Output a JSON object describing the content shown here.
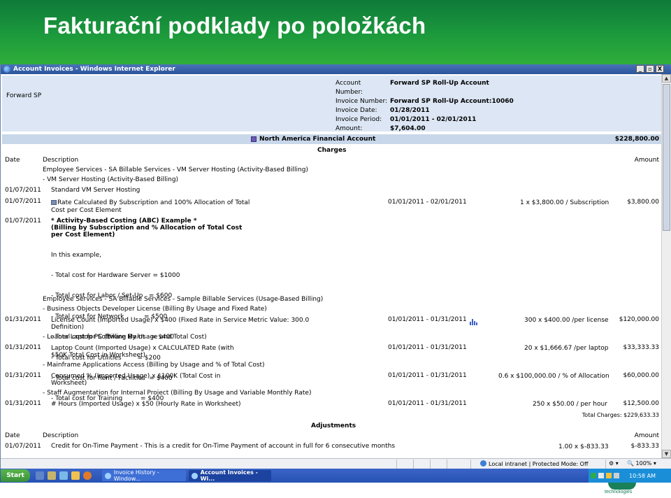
{
  "slide": {
    "title": "Fakturační podklady po položkách"
  },
  "window": {
    "title": "Account Invoices - Windows Internet Explorer",
    "buttons": [
      "_",
      "▫",
      "X"
    ]
  },
  "account": {
    "name": "Forward SP",
    "fields": [
      {
        "label": "Account Number:",
        "value": "Forward SP Roll-Up Account"
      },
      {
        "label": "Invoice Number:",
        "value": "Forward SP Roll-Up Account:10060"
      },
      {
        "label": "Invoice Date:",
        "value": "01/28/2011"
      },
      {
        "label": "Invoice Period:",
        "value": "01/01/2011 - 02/01/2011"
      },
      {
        "label": "Amount:",
        "value": "$7,604.00"
      }
    ]
  },
  "financial_account": {
    "name": "North America Financial Account",
    "amount": "$228,800.00"
  },
  "charges": {
    "heading": "Charges",
    "col_date": "Date",
    "col_desc": "Description",
    "col_amount": "Amount",
    "group1": "Employee Services - SA Billable Services - VM Server Hosting (Activity-Based Billing)",
    "sub1": "- VM Server Hosting (Activity-Based Billing)",
    "row1": {
      "date": "01/07/2011",
      "desc": "Standard VM Server Hosting"
    },
    "row2": {
      "date": "01/07/2011",
      "desc1": "Rate Calculated By Subscription and 100% Allocation of Total",
      "desc2": "Cost per Cost Element",
      "period": "01/01/2011 - 02/01/2011",
      "qty": "1 x $3,800.00  / Subscription",
      "amount": "$3,800.00"
    },
    "row3": {
      "date": "01/07/2011",
      "title1": "* Activity-Based Costing (ABC) Example *",
      "title2": "(Billing by Subscription and % Allocation of Total Cost",
      "title3": "per Cost Element)",
      "lines": [
        "In this example,",
        "- Total cost for Hardware Server = $1000",
        "- Total cost for Labor / Set-Up   = $600",
        "- Total cost for Network          = $500",
        "- Total cost for Software Maint   = $400",
        "- Total cost for Utilities        = $200",
        "- Total cost for Rent / Facilities  = $400",
        "- Total cost for Training         = $400"
      ]
    },
    "group2": "Employee Services - SA Billable Services - Sample Billable Services (Usage-Based Billing)",
    "sub2": "- Business Objects Developer License (Billing By Usage and Fixed Rate)",
    "row4": {
      "date": "01/31/2011",
      "desc1": "License Count (Imported Usage) x $400 (Fixed Rate in Service",
      "desc2": "Definition)",
      "metric": "Metric Value: 300.0",
      "period": "01/01/2011 - 01/31/2011",
      "qty": "300 x $400.00  /per license",
      "amount": "$120,000.00"
    },
    "sub3": "- Loaner Laptop PC (Billing By Usage and Total Cost)",
    "row5": {
      "date": "01/31/2011",
      "desc1": "Laptop Count (Imported Usage) x CALCULATED Rate (with",
      "desc2": "$50K Total Cost in Worksheet)",
      "period": "01/01/2011 - 01/31/2011",
      "qty": "20 x $1,666.67  /per laptop",
      "amount": "$33,333.33"
    },
    "sub4": "- Mainframe Applications Access (Billing by Usage and % of Total Cost)",
    "row6": {
      "date": "01/31/2011",
      "desc1": "Consumed % (Imported Usage) x $100K (Total Cost in",
      "desc2": "Worksheet)",
      "period": "01/01/2011 - 01/31/2011",
      "qty": "0.6 x $100,000.00  / % of Allocation",
      "amount": "$60,000.00"
    },
    "sub5": "- Staff Augmentation for Internal Project (Billing By Usage and Variable Monthly Rate)",
    "row7": {
      "date": "01/31/2011",
      "desc": "# Hours (Imported Usage) x $50 (Hourly Rate in Worksheet)",
      "period": "01/01/2011 - 01/31/2011",
      "qty": "250 x $50.00  / per hour",
      "amount": "$12,500.00"
    },
    "total": "Total Charges: $229,633.33"
  },
  "adjustments": {
    "heading": "Adjustments",
    "col_date": "Date",
    "col_desc": "Description",
    "col_amount": "Amount",
    "row1": {
      "date": "01/07/2011",
      "desc": "Credit for On-Time Payment - This is a credit for On-Time Payment of account in full for 6 consecutive months",
      "qty": "1.00 x $-833.33",
      "amount": "$-833.33"
    }
  },
  "statusbar": {
    "zone": "Local intranet | Protected Mode: Off",
    "zoom": "100%"
  },
  "taskbar": {
    "start": "Start",
    "tasks": [
      "Invoice History - Window...",
      "Account Invoices - Wi..."
    ],
    "clock": "10:58 AM"
  },
  "logo": {
    "text": "technologies"
  }
}
